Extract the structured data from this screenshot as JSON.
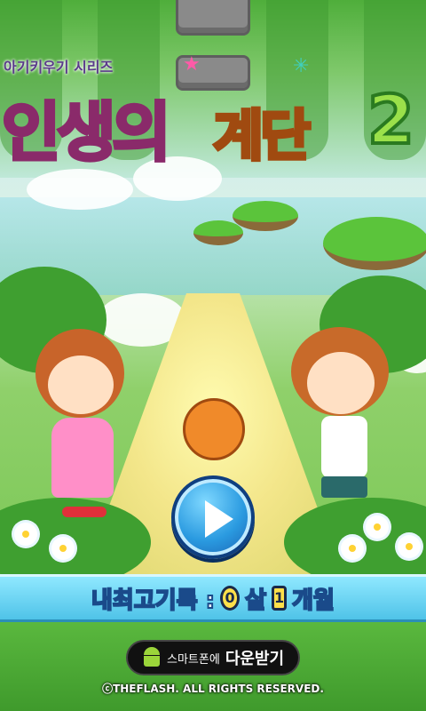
{
  "header": {
    "series_label": "아기키우기 시리즈",
    "title_part1": "인생의",
    "title_part2": "계단",
    "title_number": "2"
  },
  "play_button": {
    "icon": "play-icon"
  },
  "record": {
    "label": "내최고기록 :",
    "years": "0",
    "years_unit": "살",
    "months": "1",
    "months_unit": "개월"
  },
  "download": {
    "small_text": "스마트폰에",
    "big_text": "다운받기",
    "icon": "android-icon"
  },
  "footer": {
    "copyright": "ⓒTHEFLASH. ALL RIGHTS RESERVED."
  },
  "colors": {
    "title_pink": "#ff8fb8",
    "title_yellow": "#ffd233",
    "title_green": "#9be04a",
    "record_bar": "#4fc3e8",
    "play_button": "#2a9ae0"
  }
}
